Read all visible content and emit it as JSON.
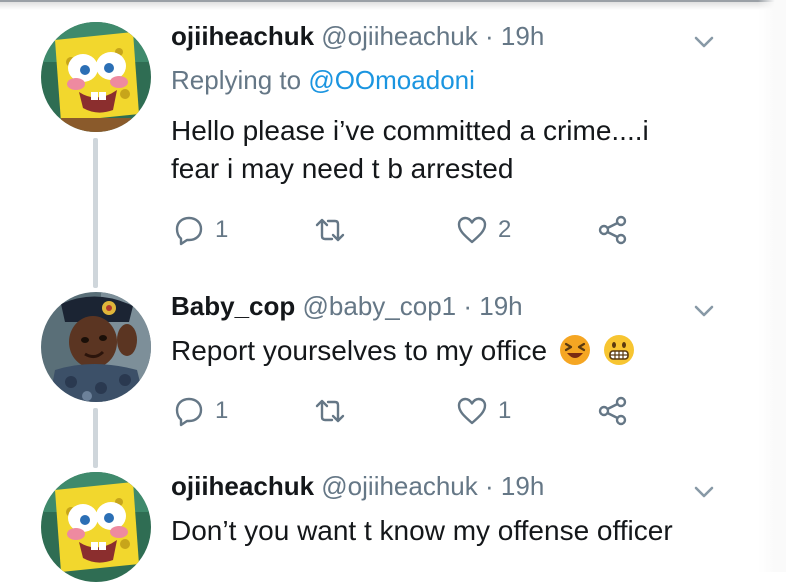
{
  "tweets": [
    {
      "name": "ojiiheachuk",
      "handle": "@ojiiheachuk",
      "separator": "·",
      "time": "19h",
      "replying_prefix": "Replying to",
      "replying_to": "@OOmoadoni",
      "lines": [
        "Hello please i’ve committed a crime....i",
        "fear i may need t b arrested"
      ],
      "replies": "1",
      "likes": "2"
    },
    {
      "name": "Baby_cop",
      "handle": "@baby_cop1",
      "separator": "·",
      "time": "19h",
      "lines": [
        "Report yourselves to my office"
      ],
      "emojis": [
        "laughing-face-icon",
        "grinning-face-icon"
      ],
      "replies": "1",
      "likes": "1"
    },
    {
      "name": "ojiiheachuk",
      "handle": "@ojiiheachuk",
      "separator": "·",
      "time": "19h",
      "lines": [
        "Don’t you want t know my offense officer"
      ]
    }
  ],
  "icons": {
    "reply": "reply-icon",
    "retweet": "retweet-icon",
    "like": "heart-icon",
    "share": "share-icon",
    "menu": "chevron-down-icon"
  },
  "colors": {
    "text": "#14171a",
    "secondary": "#657786",
    "link": "#1b95e0",
    "thread_line": "#cfd6db"
  }
}
